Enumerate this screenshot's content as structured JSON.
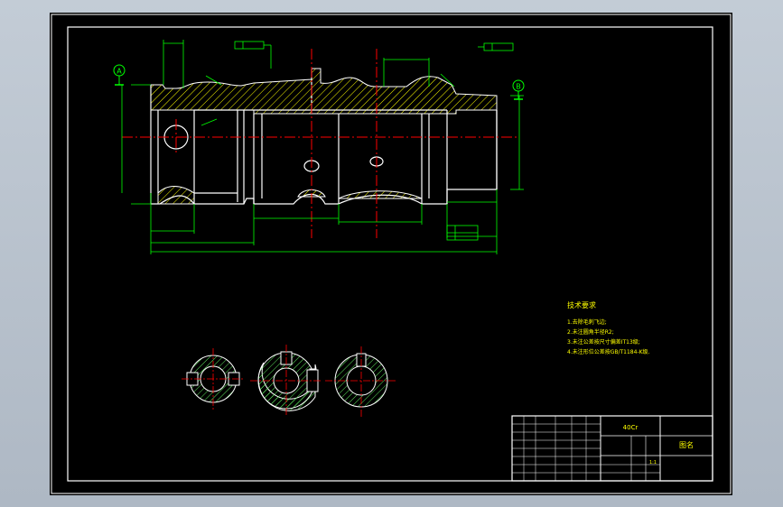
{
  "colors": {
    "background": "#000000",
    "outline": "#ffffff",
    "dimension": "#00ff00",
    "centerline": "#ff0000",
    "hatch": "#ffff00",
    "notes": "#ffff00"
  },
  "datums": {
    "a": "A",
    "b": "B"
  },
  "notes": {
    "title": "技术要求",
    "items": [
      "1.去除毛刺飞边;",
      "2.未注圆角半径R2;",
      "3.未注公差按尺寸偏差IT13级;",
      "4.未注形位公差按GB/T1184-K级."
    ]
  },
  "title_block": {
    "drawing_name": "40Cr",
    "company": "图名",
    "scale": "1:1"
  }
}
